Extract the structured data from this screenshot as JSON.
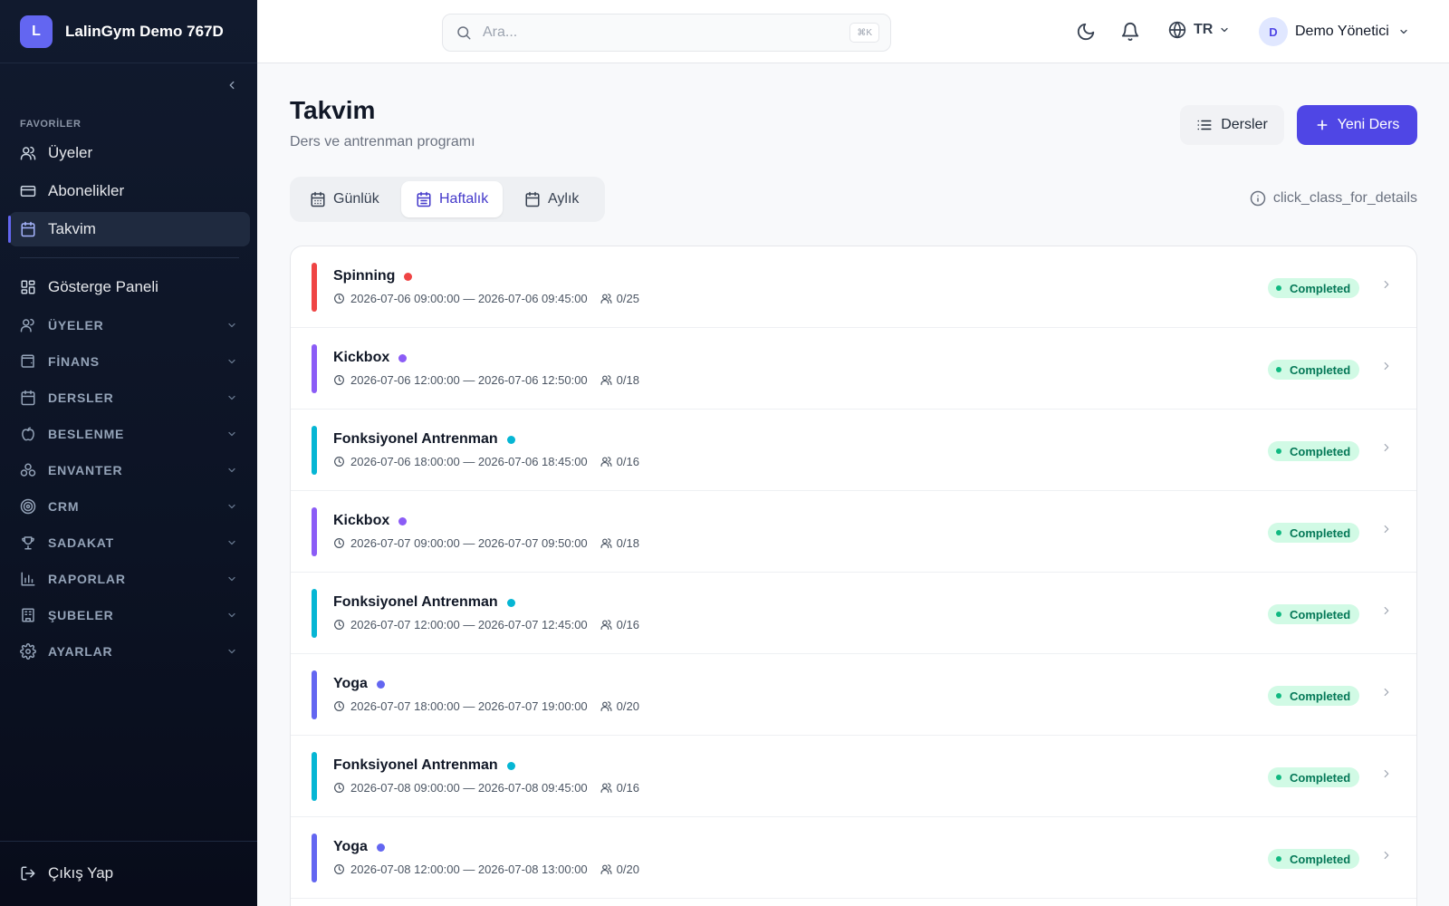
{
  "brand": {
    "initial": "L",
    "name": "LalinGym Demo 767D"
  },
  "sidebar": {
    "favorites_label": "FAVORİLER",
    "favorites": [
      {
        "label": "Üyeler",
        "icon": "users-icon"
      },
      {
        "label": "Abonelikler",
        "icon": "card-icon"
      },
      {
        "label": "Takvim",
        "icon": "calendar-icon",
        "active": true
      }
    ],
    "dashboard": {
      "label": "Gösterge Paneli",
      "icon": "dashboard-icon"
    },
    "groups": [
      {
        "label": "ÜYELER",
        "icon": "users-icon"
      },
      {
        "label": "FİNANS",
        "icon": "wallet-icon"
      },
      {
        "label": "DERSLER",
        "icon": "calendar-icon"
      },
      {
        "label": "BESLENME",
        "icon": "apple-icon"
      },
      {
        "label": "ENVANTER",
        "icon": "boxes-icon"
      },
      {
        "label": "CRM",
        "icon": "target-icon"
      },
      {
        "label": "SADAKAT",
        "icon": "trophy-icon"
      },
      {
        "label": "RAPORLAR",
        "icon": "bar-chart-icon"
      },
      {
        "label": "ŞUBELER",
        "icon": "building-icon"
      },
      {
        "label": "AYARLAR",
        "icon": "gear-icon"
      }
    ],
    "logout": "Çıkış Yap"
  },
  "header": {
    "search_placeholder": "Ara...",
    "search_shortcut": "⌘K",
    "language": "TR",
    "user_initial": "D",
    "user_name": "Demo Yönetici"
  },
  "page": {
    "title": "Takvim",
    "subtitle": "Ders ve antrenman programı",
    "classes_button": "Dersler",
    "new_class_button": "Yeni Ders",
    "tabs": [
      "Günlük",
      "Haftalık",
      "Aylık"
    ],
    "active_tab": "Haftalık",
    "hint": "click_class_for_details"
  },
  "colors": {
    "accent": "#4f46e5",
    "Spinning": "#ef4444",
    "Kickbox": "#8b5cf6",
    "Fonksiyonel Antrenman": "#06b6d4",
    "Yoga": "#6366f1",
    "status_completed_bg": "#d1fae5",
    "status_completed_text": "#047857"
  },
  "classes": [
    {
      "name": "Spinning",
      "time": "2026-07-06 09:00:00 — 2026-07-06 09:45:00",
      "capacity": "0/25",
      "status": "Completed",
      "color": "#ef4444"
    },
    {
      "name": "Kickbox",
      "time": "2026-07-06 12:00:00 — 2026-07-06 12:50:00",
      "capacity": "0/18",
      "status": "Completed",
      "color": "#8b5cf6"
    },
    {
      "name": "Fonksiyonel Antrenman",
      "time": "2026-07-06 18:00:00 — 2026-07-06 18:45:00",
      "capacity": "0/16",
      "status": "Completed",
      "color": "#06b6d4"
    },
    {
      "name": "Kickbox",
      "time": "2026-07-07 09:00:00 — 2026-07-07 09:50:00",
      "capacity": "0/18",
      "status": "Completed",
      "color": "#8b5cf6"
    },
    {
      "name": "Fonksiyonel Antrenman",
      "time": "2026-07-07 12:00:00 — 2026-07-07 12:45:00",
      "capacity": "0/16",
      "status": "Completed",
      "color": "#06b6d4"
    },
    {
      "name": "Yoga",
      "time": "2026-07-07 18:00:00 — 2026-07-07 19:00:00",
      "capacity": "0/20",
      "status": "Completed",
      "color": "#6366f1"
    },
    {
      "name": "Fonksiyonel Antrenman",
      "time": "2026-07-08 09:00:00 — 2026-07-08 09:45:00",
      "capacity": "0/16",
      "status": "Completed",
      "color": "#06b6d4"
    },
    {
      "name": "Yoga",
      "time": "2026-07-08 12:00:00 — 2026-07-08 13:00:00",
      "capacity": "0/20",
      "status": "Completed",
      "color": "#6366f1"
    }
  ]
}
